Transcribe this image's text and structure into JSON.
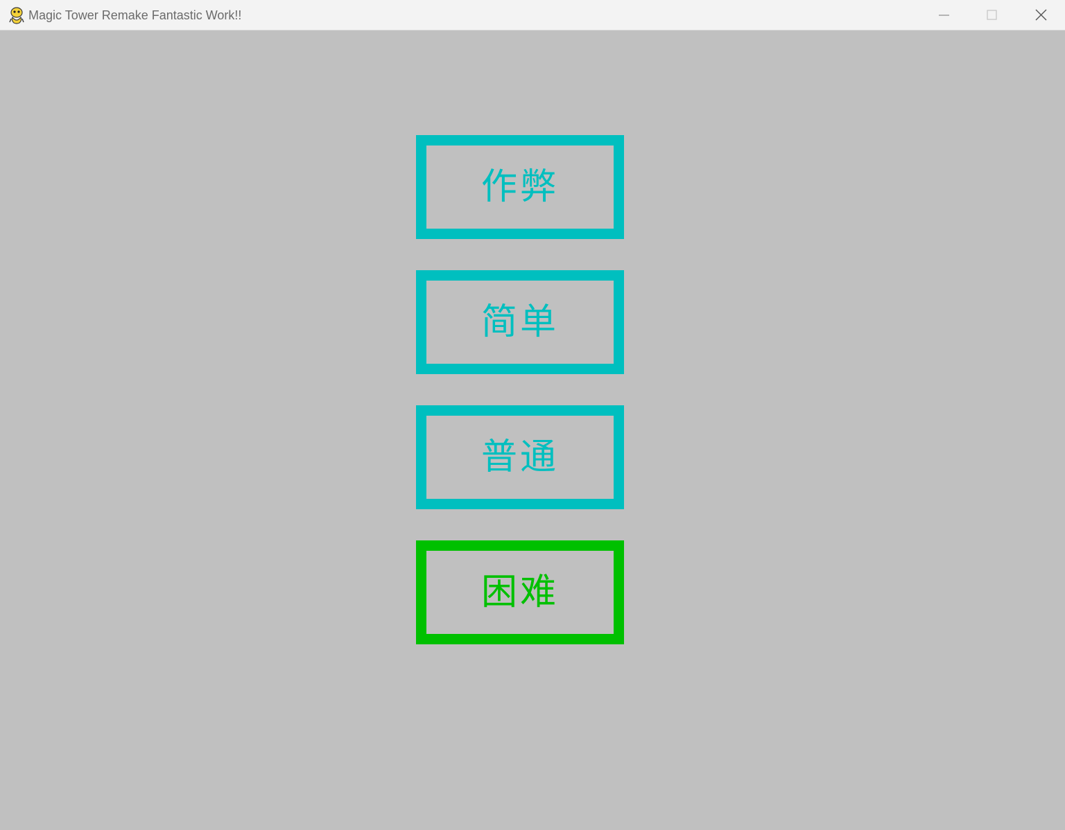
{
  "window": {
    "title": "Magic Tower Remake Fantastic Work!!",
    "app_icon": "pygame-snake-icon",
    "controls": [
      "minimize-icon",
      "maximize-icon",
      "close-icon"
    ]
  },
  "colors": {
    "background": "#c0c0c0",
    "option_normal": "#00bfbf",
    "option_selected": "#00c000"
  },
  "menu": {
    "options": [
      {
        "label": "作弊",
        "selected": false
      },
      {
        "label": "简单",
        "selected": false
      },
      {
        "label": "普通",
        "selected": false
      },
      {
        "label": "困难",
        "selected": true
      }
    ]
  }
}
